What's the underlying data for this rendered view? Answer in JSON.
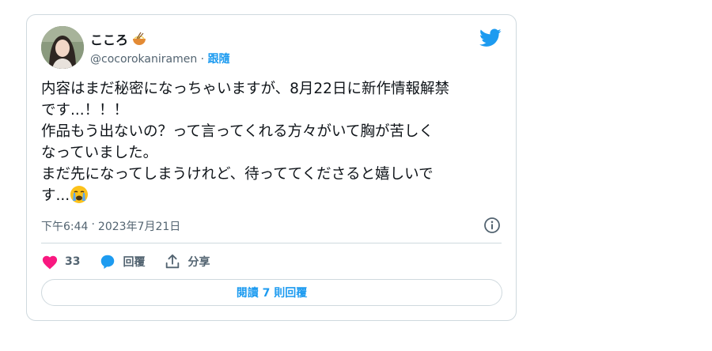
{
  "tweet": {
    "display_name": "こころ",
    "handle": "@cocorokaniramen",
    "separator": "·",
    "follow_label": "跟隨",
    "text_main": "内容はまだ秘密になっちゃいますが、8月22日に新作情報解禁\nです...！！！\n作品もう出ないの？って言ってくれる方々がいて胸が苦しく\nなっていました。\nまだ先になってしまうけれど、待っててくださると嬉しいで\nす...",
    "time": "下午6:44",
    "dot": "·",
    "date": "2023年7月21日",
    "likes_count": "33",
    "reply_label": "回覆",
    "share_label": "分享",
    "read_replies_label": "閱讀 7 則回覆"
  },
  "icons": {
    "avatar": "avatar-photo",
    "name_emoji": "noodle-bowl-icon",
    "logo": "twitter-bird-icon",
    "text_emoji": "crying-face-icon",
    "info": "info-icon",
    "like": "heart-icon",
    "reply": "speech-bubble-icon",
    "share": "share-upload-icon"
  },
  "colors": {
    "accent": "#1d9bf0",
    "like": "#f91880",
    "secondary_text": "#536471",
    "border": "#cfd9de"
  }
}
